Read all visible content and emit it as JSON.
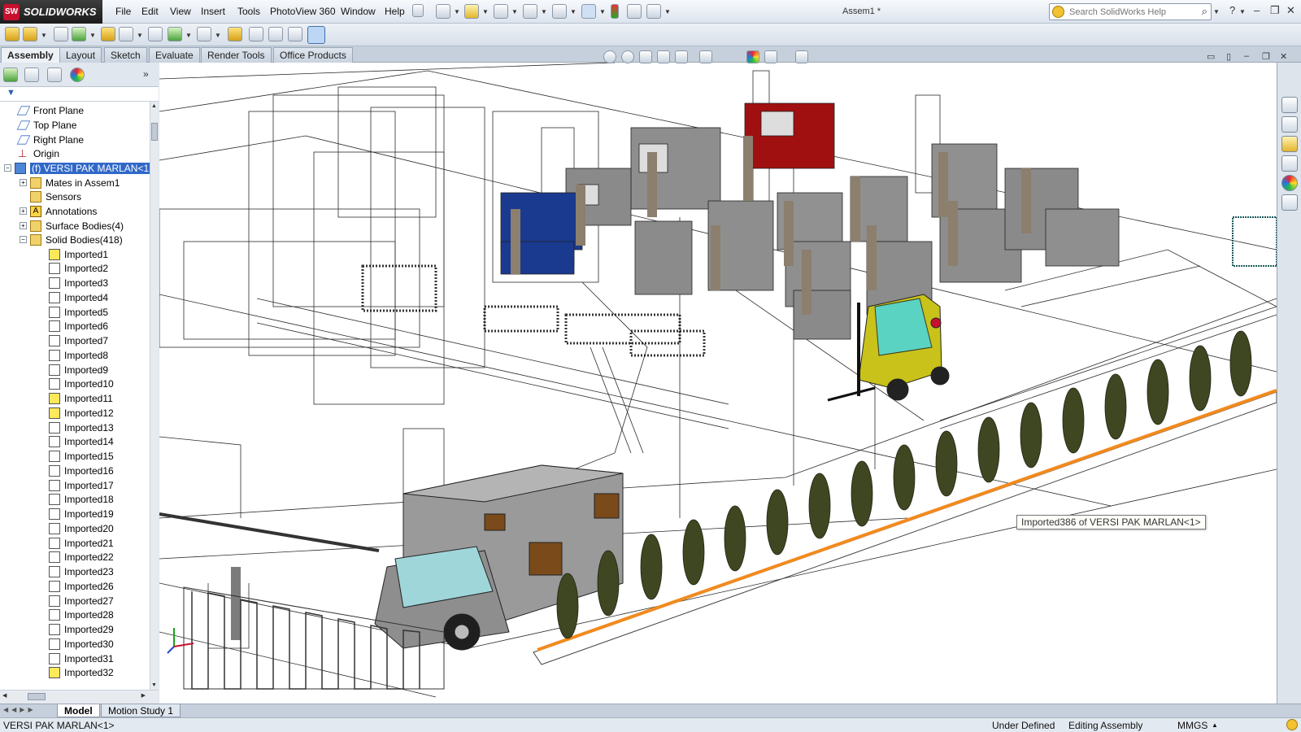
{
  "app": {
    "logo_text": "SOLIDWORKS",
    "logo_mark": "SW",
    "document_title": "Assem1 *"
  },
  "menu": [
    "File",
    "Edit",
    "View",
    "Insert",
    "Tools",
    "PhotoView 360",
    "Window",
    "Help"
  ],
  "search": {
    "placeholder": "Search SolidWorks Help"
  },
  "command_tabs": [
    {
      "label": "Assembly",
      "active": true
    },
    {
      "label": "Layout"
    },
    {
      "label": "Sketch"
    },
    {
      "label": "Evaluate"
    },
    {
      "label": "Render Tools"
    },
    {
      "label": "Office Products"
    }
  ],
  "tree": {
    "planes": [
      "Front Plane",
      "Top Plane",
      "Right Plane"
    ],
    "origin": "Origin",
    "assembly": "(f) VERSI PAK MARLAN<1",
    "folders": [
      "Mates in Assem1",
      "Sensors",
      "Annotations",
      "Surface Bodies(4)",
      "Solid Bodies(418)"
    ],
    "bodies": [
      "Imported1",
      "Imported2",
      "Imported3",
      "Imported4",
      "Imported5",
      "Imported6",
      "Imported7",
      "Imported8",
      "Imported9",
      "Imported10",
      "Imported11",
      "Imported12",
      "Imported13",
      "Imported14",
      "Imported15",
      "Imported16",
      "Imported17",
      "Imported18",
      "Imported19",
      "Imported20",
      "Imported21",
      "Imported22",
      "Imported23",
      "Imported26",
      "Imported27",
      "Imported28",
      "Imported29",
      "Imported30",
      "Imported31",
      "Imported32"
    ]
  },
  "viewport": {
    "tooltip": "Imported386 of VERSI PAK MARLAN<1>"
  },
  "bottom_tabs": [
    {
      "label": "Model",
      "active": true
    },
    {
      "label": "Motion Study 1"
    }
  ],
  "status": {
    "selection": "VERSI PAK MARLAN<1>",
    "definition": "Under Defined",
    "mode": "Editing Assembly",
    "units": "MMGS",
    "units_arrow": "▲"
  },
  "colors": {
    "orange_rail": "#f28a1e",
    "selection_blue": "#3168c8",
    "forklift_yellow": "#c9c21a",
    "red_machine": "#a01010",
    "blue_machine": "#1a3a8f"
  }
}
